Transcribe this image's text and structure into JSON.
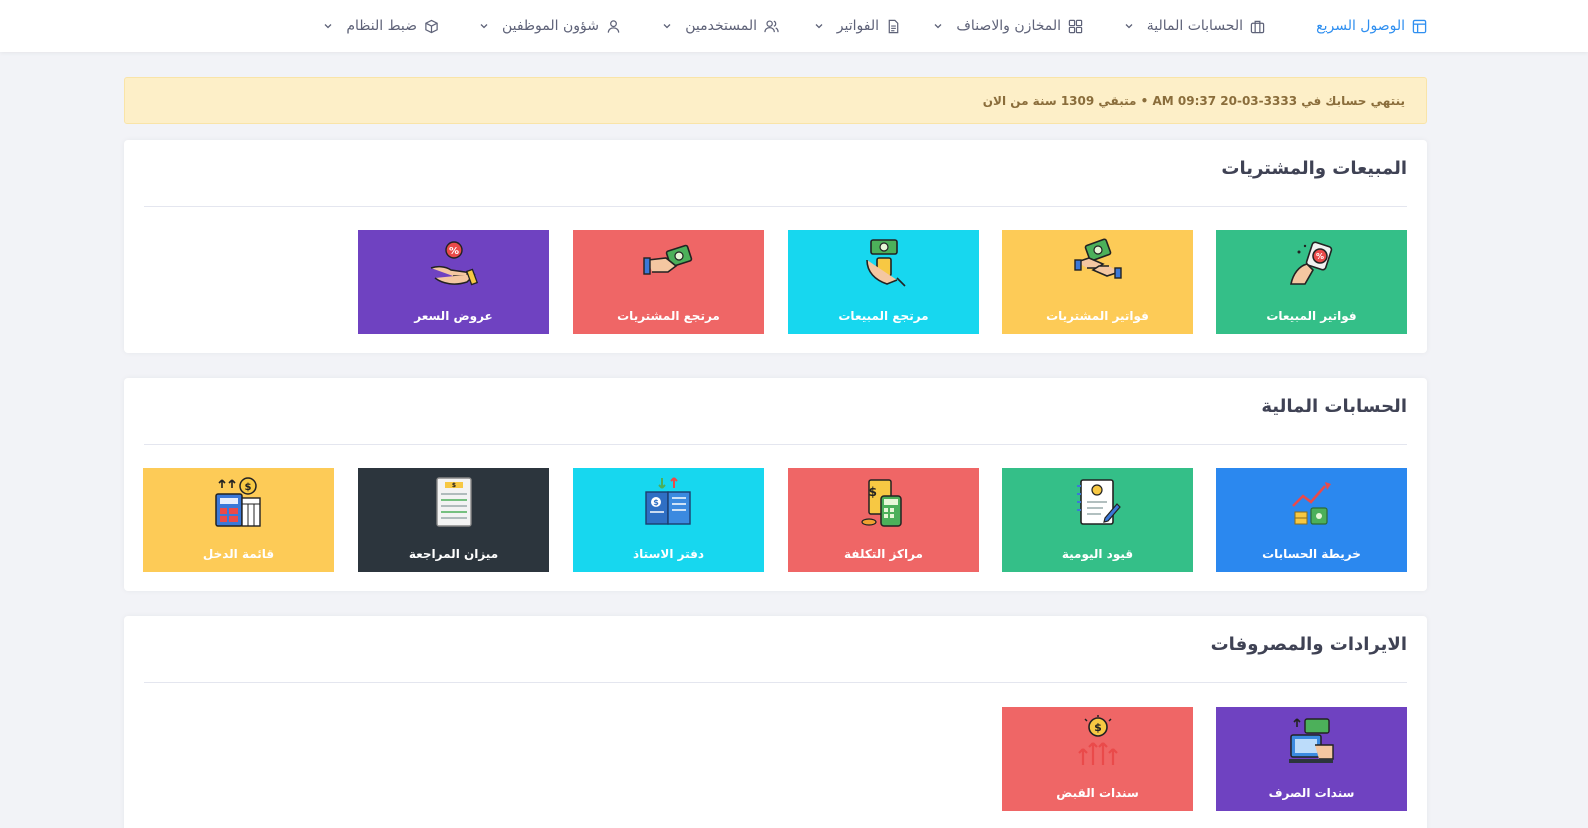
{
  "nav": {
    "items": [
      {
        "label": "الوصول السريع",
        "icon": "layout-icon",
        "active": true
      },
      {
        "label": "الحسابات المالية",
        "icon": "briefcase-icon"
      },
      {
        "label": "المخازن والاصناف",
        "icon": "grid-icon"
      },
      {
        "label": "الفواتير",
        "icon": "document-icon"
      },
      {
        "label": "المستخدمين",
        "icon": "users-icon"
      },
      {
        "label": "شؤون الموظفين",
        "icon": "user-icon"
      },
      {
        "label": "ضبط النظام",
        "icon": "box-icon"
      }
    ]
  },
  "alert": {
    "text": "ينتهي حسابك في 3333-03-20 09:37 AM • متبقي 1309 سنة من الان"
  },
  "sections": [
    {
      "title": "المبيعات والمشتريات",
      "tiles": [
        {
          "label": "فواتير المبيعات",
          "color": "#34bf88",
          "icon": "sales-invoice-icon"
        },
        {
          "label": "فواتير المشتريات",
          "color": "#fdcb57",
          "icon": "purchase-invoice-icon"
        },
        {
          "label": "مرتجع المبيعات",
          "color": "#17d7ef",
          "icon": "sales-return-icon"
        },
        {
          "label": "مرتجع المشتريات",
          "color": "#ef6666",
          "icon": "purchase-return-icon"
        },
        {
          "label": "عروض السعر",
          "color": "#6f42c1",
          "icon": "price-offer-icon"
        }
      ]
    },
    {
      "title": "الحسابات المالية",
      "tiles": [
        {
          "label": "خريطة الحسابات",
          "color": "#2b88ef",
          "icon": "accounts-chart-icon"
        },
        {
          "label": "قيود اليومية",
          "color": "#34bf88",
          "icon": "journal-icon"
        },
        {
          "label": "مراكز التكلفة",
          "color": "#ef6666",
          "icon": "cost-center-icon"
        },
        {
          "label": "دفتر الاستاذ",
          "color": "#17d7ef",
          "icon": "ledger-icon"
        },
        {
          "label": "ميزان المراجعة",
          "color": "#2c353d",
          "icon": "trial-balance-icon"
        },
        {
          "label": "قائمة الدخل",
          "color": "#fdcb57",
          "icon": "income-statement-icon"
        }
      ]
    },
    {
      "title": "الايرادات والمصروفات",
      "tiles": [
        {
          "label": "سندات الصرف",
          "color": "#6f42c1",
          "icon": "payment-voucher-icon"
        },
        {
          "label": "سندات القبض",
          "color": "#ef6666",
          "icon": "receipt-voucher-icon"
        }
      ]
    }
  ]
}
